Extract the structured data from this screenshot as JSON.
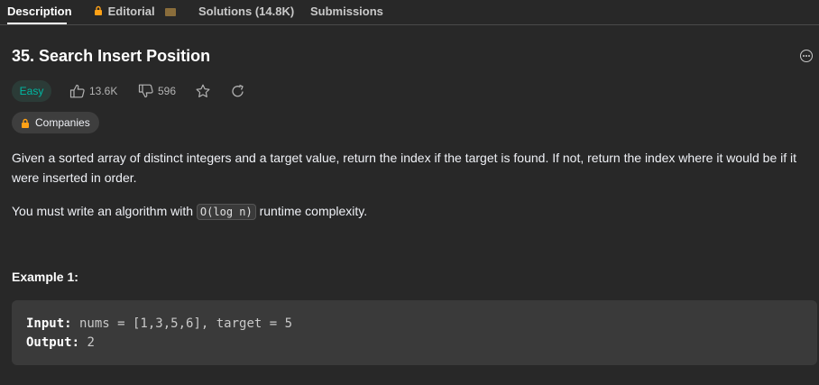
{
  "tabs": {
    "description": "Description",
    "editorial": "Editorial",
    "solutions": "Solutions (14.8K)",
    "submissions": "Submissions"
  },
  "problem": {
    "title": "35. Search Insert Position",
    "difficulty": "Easy",
    "likes": "13.6K",
    "dislikes": "596",
    "companies_label": "Companies"
  },
  "description": {
    "paragraph1": "Given a sorted array of distinct integers and a target value, return the index if the target is found. If not, return the index where it would be if it were inserted in order.",
    "paragraph2_before": "You must write an algorithm with ",
    "paragraph2_code": "O(log n)",
    "paragraph2_after": " runtime complexity."
  },
  "example1": {
    "title": "Example 1:",
    "input_label": "Input:",
    "input_value": " nums = [1,3,5,6], target = 5",
    "output_label": "Output:",
    "output_value": " 2"
  },
  "colors": {
    "background": "#282828",
    "easy": "#00b8a3",
    "lock": "#ffa116"
  },
  "icons": [
    "lock-icon",
    "video-icon",
    "thumbs-up-icon",
    "thumbs-down-icon",
    "star-icon",
    "share-icon",
    "more-icon"
  ]
}
